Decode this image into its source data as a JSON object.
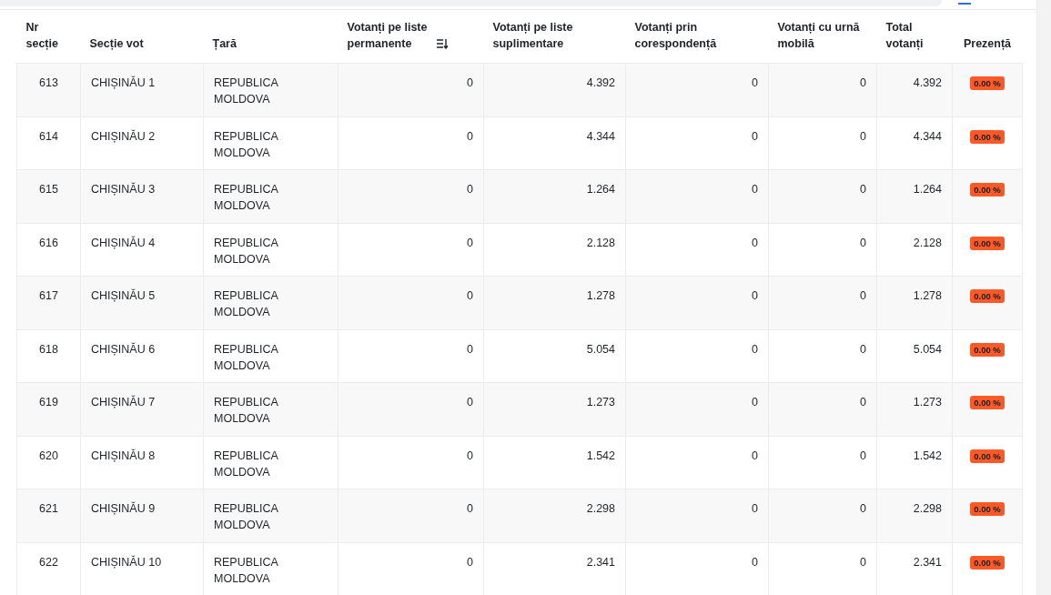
{
  "table": {
    "columns": [
      {
        "label": "Nr secție",
        "sortable": false
      },
      {
        "label": "Secție vot",
        "sortable": false
      },
      {
        "label": "Țară",
        "sortable": false
      },
      {
        "label": "Votanți pe liste permanente",
        "sortable": true
      },
      {
        "label": "Votanți pe liste suplimentare",
        "sortable": false
      },
      {
        "label": "Votanți prin corespondență",
        "sortable": false
      },
      {
        "label": "Votanți cu urnă mobilă",
        "sortable": false
      },
      {
        "label": "Total votanți",
        "sortable": false
      },
      {
        "label": "Prezență",
        "sortable": false
      }
    ],
    "rows": [
      {
        "cells": [
          "613",
          "CHIȘINĂU 1",
          "REPUBLICA MOLDOVA",
          "0",
          "4.392",
          "0",
          "0",
          "4.392"
        ],
        "turnout": "0.00 %"
      },
      {
        "cells": [
          "614",
          "CHIȘINĂU 2",
          "REPUBLICA MOLDOVA",
          "0",
          "4.344",
          "0",
          "0",
          "4.344"
        ],
        "turnout": "0.00 %"
      },
      {
        "cells": [
          "615",
          "CHIȘINĂU 3",
          "REPUBLICA MOLDOVA",
          "0",
          "1.264",
          "0",
          "0",
          "1.264"
        ],
        "turnout": "0.00 %"
      },
      {
        "cells": [
          "616",
          "CHIȘINĂU 4",
          "REPUBLICA MOLDOVA",
          "0",
          "2.128",
          "0",
          "0",
          "2.128"
        ],
        "turnout": "0.00 %"
      },
      {
        "cells": [
          "617",
          "CHIȘINĂU 5",
          "REPUBLICA MOLDOVA",
          "0",
          "1.278",
          "0",
          "0",
          "1.278"
        ],
        "turnout": "0.00 %"
      },
      {
        "cells": [
          "618",
          "CHIȘINĂU 6",
          "REPUBLICA MOLDOVA",
          "0",
          "5.054",
          "0",
          "0",
          "5.054"
        ],
        "turnout": "0.00 %"
      },
      {
        "cells": [
          "619",
          "CHIȘINĂU 7",
          "REPUBLICA MOLDOVA",
          "0",
          "1.273",
          "0",
          "0",
          "1.273"
        ],
        "turnout": "0.00 %"
      },
      {
        "cells": [
          "620",
          "CHIȘINĂU 8",
          "REPUBLICA MOLDOVA",
          "0",
          "1.542",
          "0",
          "0",
          "1.542"
        ],
        "turnout": "0.00 %"
      },
      {
        "cells": [
          "621",
          "CHIȘINĂU 9",
          "REPUBLICA MOLDOVA",
          "0",
          "2.298",
          "0",
          "0",
          "2.298"
        ],
        "turnout": "0.00 %"
      },
      {
        "cells": [
          "622",
          "CHIȘINĂU 10",
          "REPUBLICA MOLDOVA",
          "0",
          "2.341",
          "0",
          "0",
          "2.341"
        ],
        "turnout": "0.00 %"
      }
    ]
  }
}
